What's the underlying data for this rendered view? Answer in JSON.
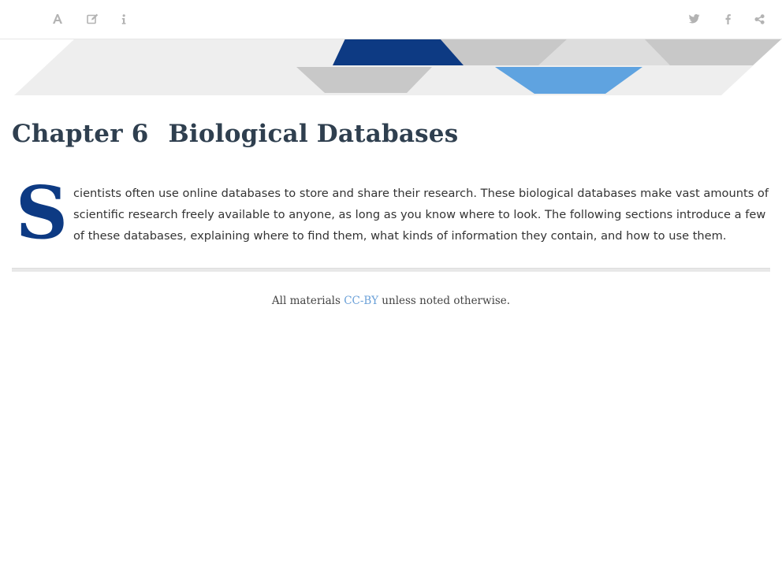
{
  "toolbar": {
    "left_buttons": [
      {
        "icon": "font-icon"
      },
      {
        "icon": "edit-icon"
      },
      {
        "icon": "info-icon"
      }
    ],
    "right_buttons": [
      {
        "icon": "twitter-icon"
      },
      {
        "icon": "facebook-icon"
      },
      {
        "icon": "share-icon"
      }
    ],
    "icon_color": "#b3b3b3"
  },
  "banner": {
    "colors": {
      "dark_blue": "#0d3a83",
      "light_blue": "#5fa3e0",
      "gray": "#c8c8c8",
      "light_gray": "#eeeeee"
    }
  },
  "chapter": {
    "number": "Chapter 6",
    "title": "Biological Databases"
  },
  "intro": {
    "drop_cap": "S",
    "text": "cientists often use online databases to store and share their research. These biological databases make vast amounts of scientific research freely available to anyone, as long as you know where to look. The following sections introduce a few of these databases, explaining where to find them, what kinds of information they contain, and how to use them."
  },
  "footer": {
    "prefix": "All materials ",
    "license_link": "CC-BY",
    "suffix": " unless noted otherwise."
  }
}
